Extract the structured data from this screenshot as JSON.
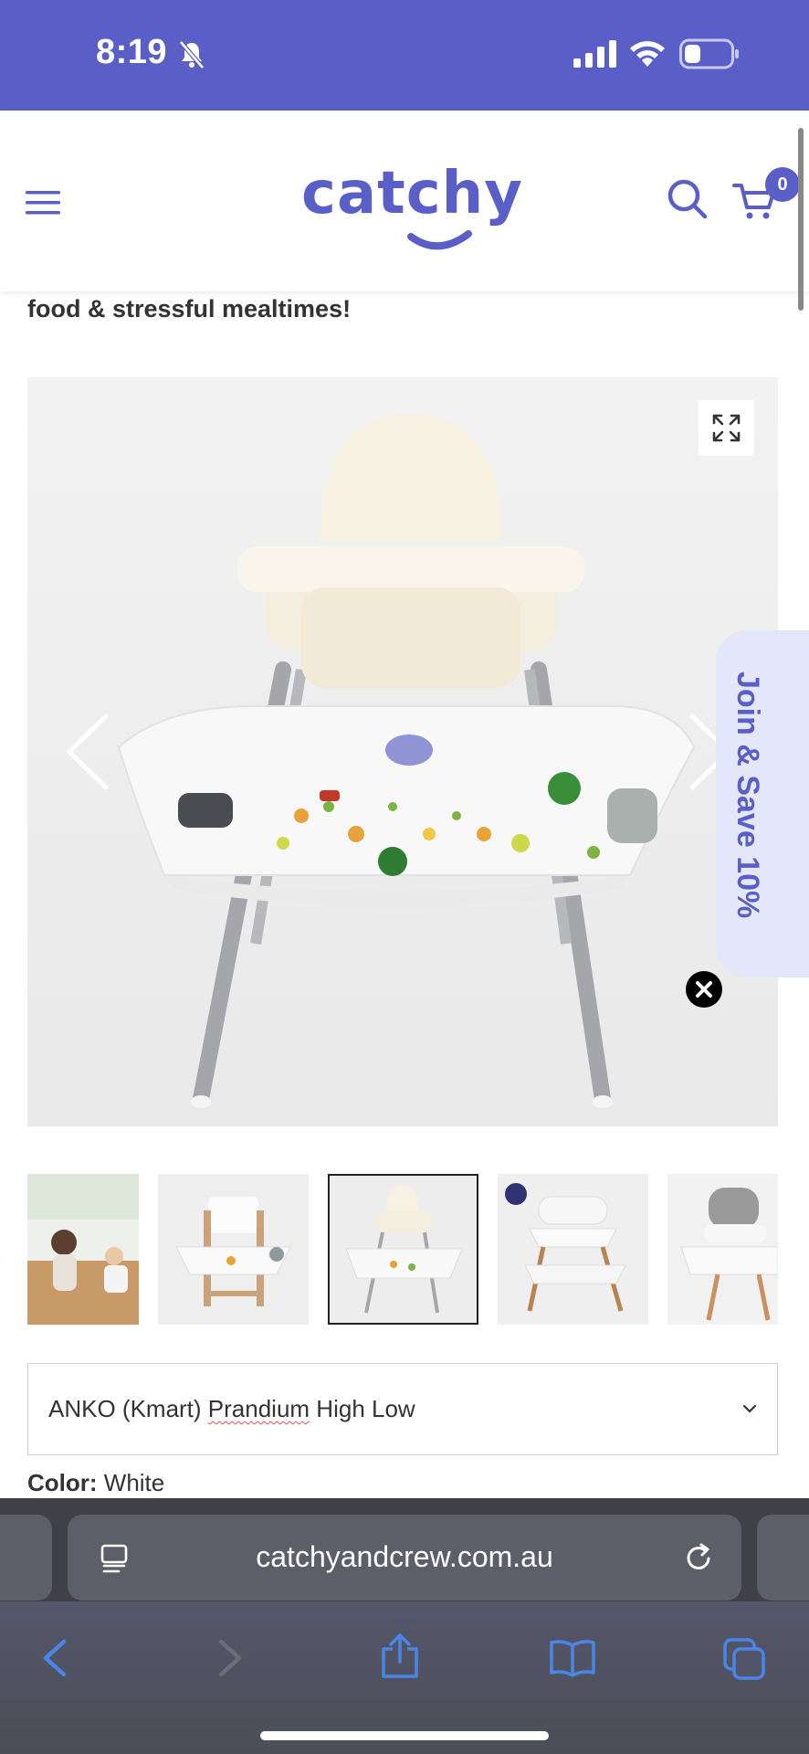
{
  "status_bar": {
    "time": "8:19"
  },
  "header": {
    "logo_text": "catchy",
    "cart_count": "0"
  },
  "content": {
    "tagline": "food & stressful mealtimes!",
    "join_tab": "Join & Save 10%",
    "variant_select": {
      "prefix": "ANKO (Kmart) ",
      "underlined": "Prandium",
      "suffix": " High Low"
    },
    "color_label": "Color:",
    "color_value": "White",
    "thumbnails": [
      "lifestyle-family",
      "wooden-highchair",
      "white-highchair",
      "wooden-leg-highchair",
      "grey-highchair"
    ],
    "active_thumbnail": 2
  },
  "browser": {
    "url": "catchyandcrew.com.au"
  },
  "colors": {
    "brand": "#5a5fc8",
    "join_tab_bg": "#e4e6fa",
    "toolbar_blue": "#4a86e8"
  }
}
